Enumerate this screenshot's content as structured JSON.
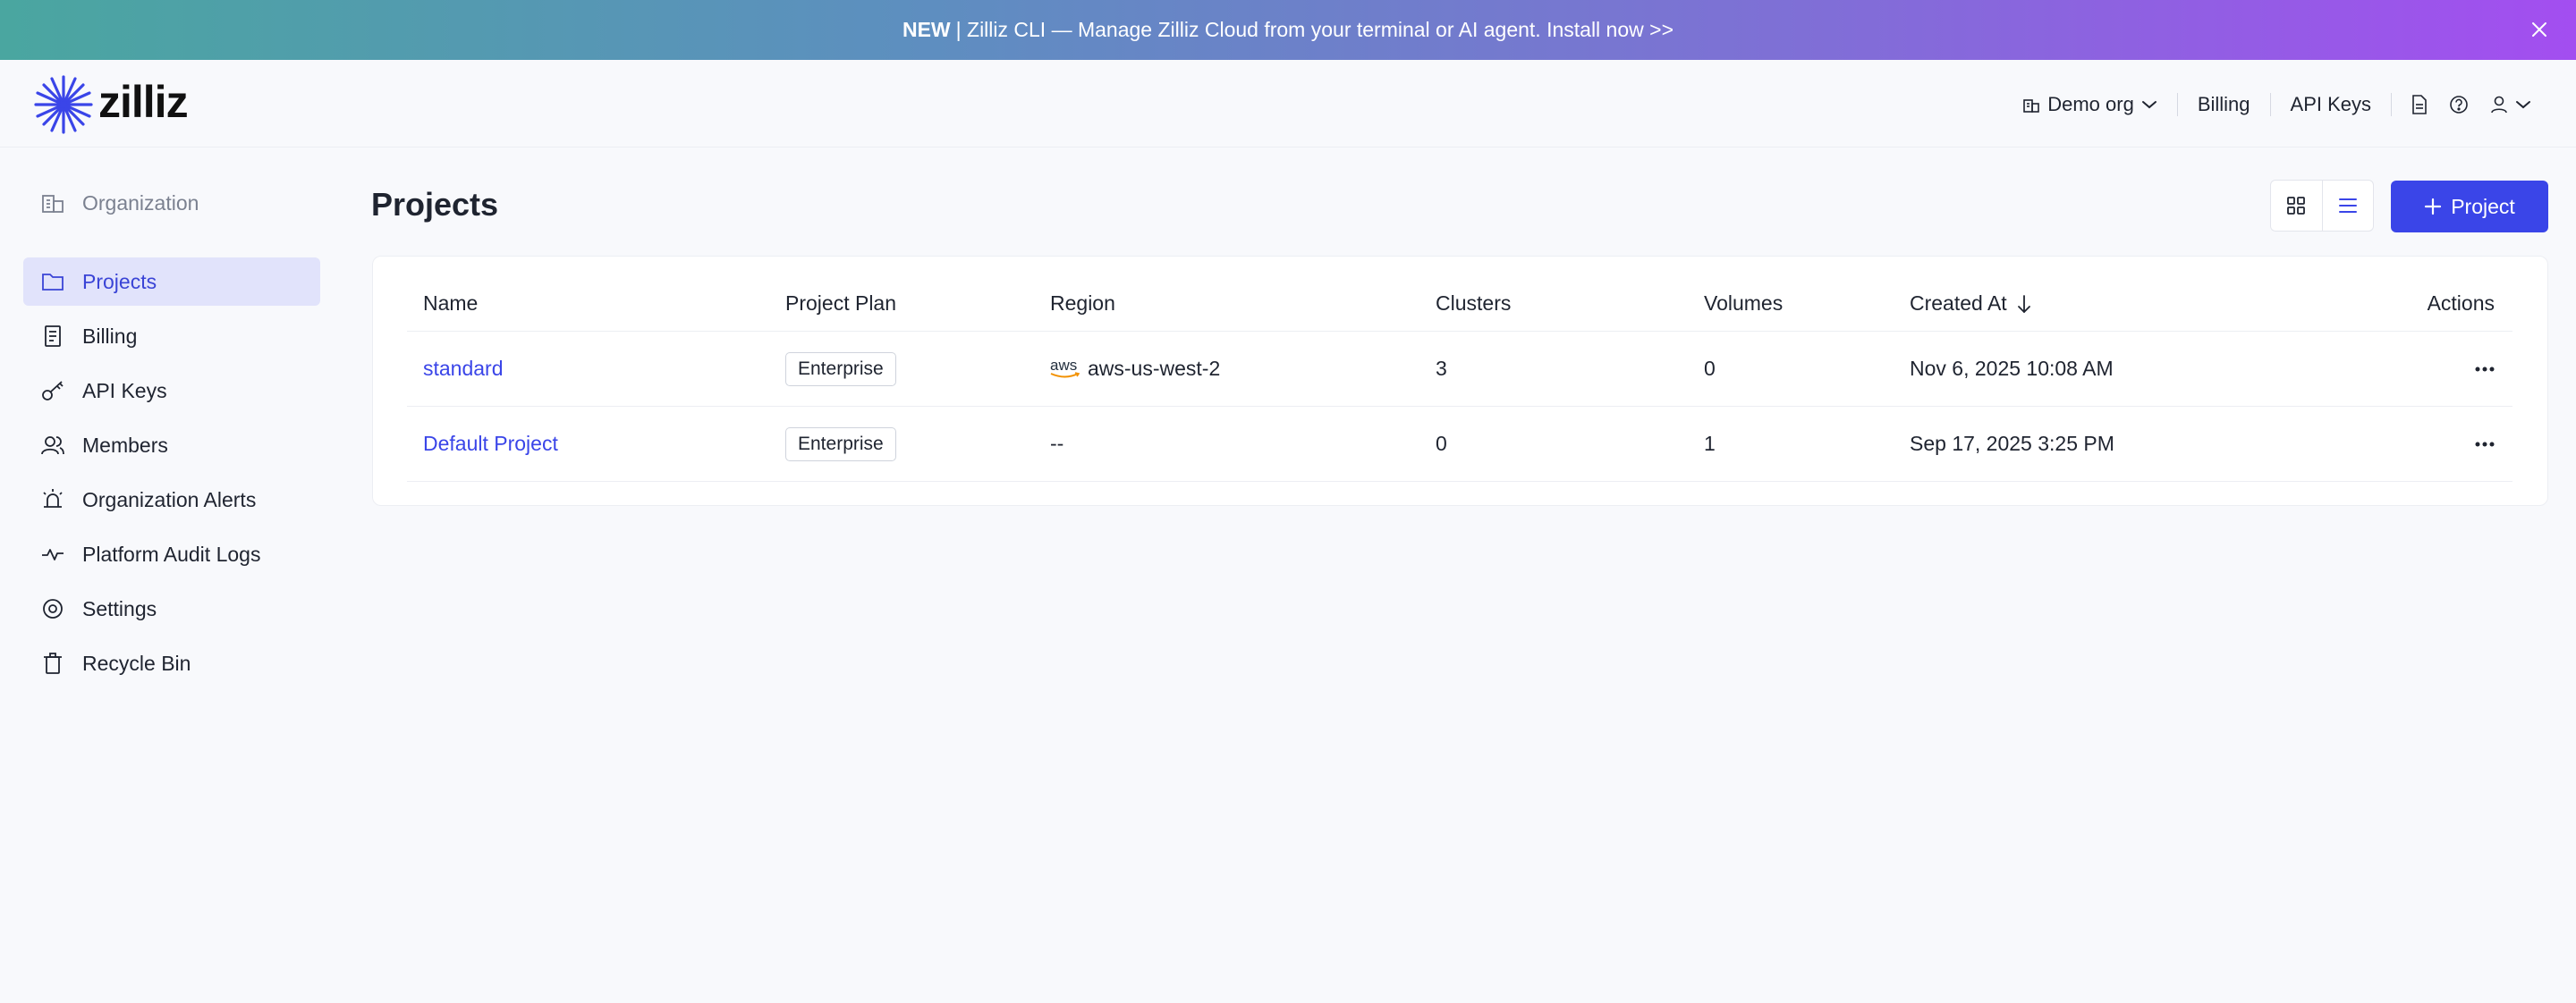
{
  "banner": {
    "new_label": "NEW",
    "text": "| Zilliz CLI — Manage Zilliz Cloud from your terminal or AI agent. Install now >>"
  },
  "header": {
    "logo_text": "zilliz",
    "org_name": "Demo org",
    "billing_label": "Billing",
    "api_keys_label": "API Keys"
  },
  "sidebar": {
    "items": [
      {
        "label": "Organization",
        "icon": "building-icon"
      },
      {
        "label": "Projects",
        "icon": "folder-icon"
      },
      {
        "label": "Billing",
        "icon": "invoice-icon"
      },
      {
        "label": "API Keys",
        "icon": "key-icon"
      },
      {
        "label": "Members",
        "icon": "users-icon"
      },
      {
        "label": "Organization Alerts",
        "icon": "alarm-icon"
      },
      {
        "label": "Platform Audit Logs",
        "icon": "activity-icon"
      },
      {
        "label": "Settings",
        "icon": "gear-icon"
      },
      {
        "label": "Recycle Bin",
        "icon": "trash-icon"
      }
    ]
  },
  "main": {
    "title": "Projects",
    "add_button_label": "Project"
  },
  "table": {
    "columns": [
      "Name",
      "Project Plan",
      "Region",
      "Clusters",
      "Volumes",
      "Created At",
      "Actions"
    ],
    "rows": [
      {
        "name": "standard",
        "plan": "Enterprise",
        "region_provider": "aws",
        "region": "aws-us-west-2",
        "clusters": "3",
        "volumes": "0",
        "created": "Nov 6, 2025 10:08 AM"
      },
      {
        "name": "Default Project",
        "plan": "Enterprise",
        "region_provider": "",
        "region": "--",
        "clusters": "0",
        "volumes": "1",
        "created": "Sep 17, 2025 3:25 PM"
      }
    ]
  },
  "colors": {
    "accent": "#3a45e8",
    "active_bg": "#e1e3fb"
  }
}
